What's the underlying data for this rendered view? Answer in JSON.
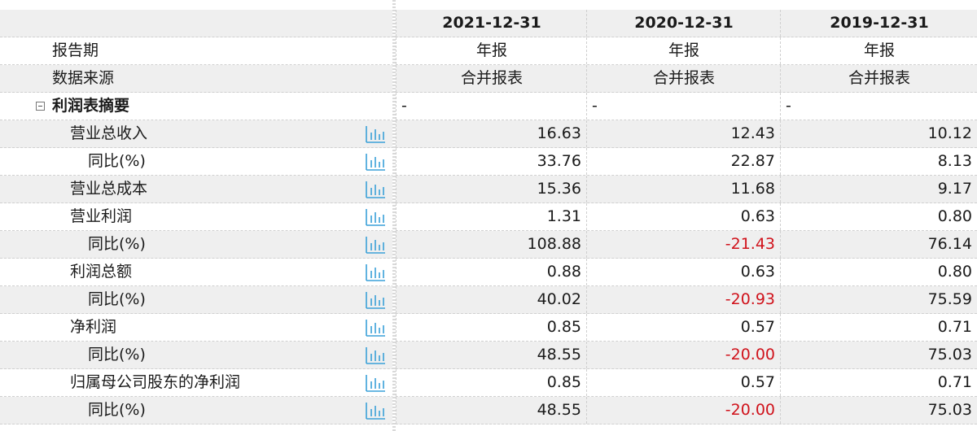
{
  "columns": [
    "2021-12-31",
    "2020-12-31",
    "2019-12-31"
  ],
  "meta_rows": [
    {
      "label": "报告期",
      "values": [
        "年报",
        "年报",
        "年报"
      ]
    },
    {
      "label": "数据来源",
      "values": [
        "合并报表",
        "合并报表",
        "合并报表"
      ]
    }
  ],
  "section": {
    "label": "利润表摘要",
    "values": [
      "-",
      "-",
      "-"
    ]
  },
  "rows": [
    {
      "label": "营业总收入",
      "values": [
        "16.63",
        "12.43",
        "10.12"
      ]
    },
    {
      "label": "同比(%)",
      "values": [
        "33.76",
        "22.87",
        "8.13"
      ]
    },
    {
      "label": "营业总成本",
      "values": [
        "15.36",
        "11.68",
        "9.17"
      ]
    },
    {
      "label": "营业利润",
      "values": [
        "1.31",
        "0.63",
        "0.80"
      ]
    },
    {
      "label": "同比(%)",
      "values": [
        "108.88",
        "-21.43",
        "76.14"
      ]
    },
    {
      "label": "利润总额",
      "values": [
        "0.88",
        "0.63",
        "0.80"
      ]
    },
    {
      "label": "同比(%)",
      "values": [
        "40.02",
        "-20.93",
        "75.59"
      ]
    },
    {
      "label": "净利润",
      "values": [
        "0.85",
        "0.57",
        "0.71"
      ]
    },
    {
      "label": "同比(%)",
      "values": [
        "48.55",
        "-20.00",
        "75.03"
      ]
    },
    {
      "label": "归属母公司股东的净利润",
      "values": [
        "0.85",
        "0.57",
        "0.71"
      ]
    },
    {
      "label": "同比(%)",
      "values": [
        "48.55",
        "-20.00",
        "75.03"
      ]
    }
  ],
  "colors": {
    "negative": "#d0121b",
    "icon": "#3aa0d8",
    "stripe": "#efefef"
  },
  "icons": {
    "collapse": "collapse-minus-icon",
    "chart": "bar-chart-icon"
  }
}
